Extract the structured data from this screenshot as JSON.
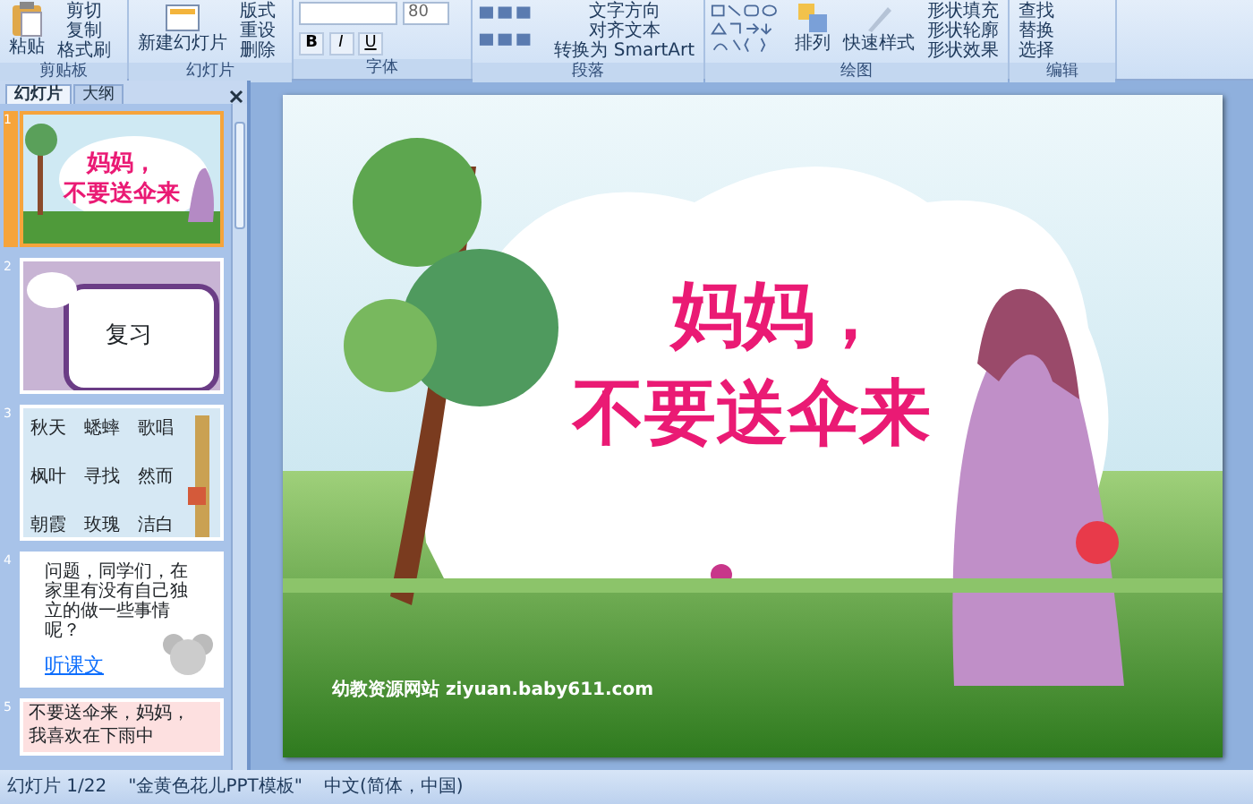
{
  "ribbon": {
    "groups": [
      {
        "label": "剪贴板",
        "items": [
          {
            "label": "粘贴",
            "kind": "large"
          },
          {
            "label": "剪切",
            "kind": "small"
          },
          {
            "label": "复制",
            "kind": "small"
          },
          {
            "label": "格式刷",
            "kind": "small"
          }
        ]
      },
      {
        "label": "幻灯片",
        "items": [
          {
            "label": "新建幻灯片",
            "kind": "large"
          },
          {
            "label": "版式",
            "kind": "small"
          },
          {
            "label": "重设",
            "kind": "small"
          },
          {
            "label": "删除",
            "kind": "small"
          }
        ]
      },
      {
        "label": "字体",
        "items": [
          {
            "label": "80",
            "kind": "fontsize"
          },
          {
            "label": "B",
            "kind": "format"
          },
          {
            "label": "I",
            "kind": "format"
          },
          {
            "label": "U",
            "kind": "format"
          }
        ]
      },
      {
        "label": "段落",
        "items": [
          {
            "label": "文字方向",
            "kind": "small"
          },
          {
            "label": "对齐文本",
            "kind": "small"
          },
          {
            "label": "转换为 SmartArt",
            "kind": "small"
          }
        ]
      },
      {
        "label": "绘图",
        "items": [
          {
            "label": "排列",
            "kind": "large"
          },
          {
            "label": "快速样式",
            "kind": "large"
          },
          {
            "label": "形状填充",
            "kind": "small"
          },
          {
            "label": "形状轮廓",
            "kind": "small"
          },
          {
            "label": "形状效果",
            "kind": "small"
          }
        ]
      },
      {
        "label": "编辑",
        "items": [
          {
            "label": "查找",
            "kind": "small"
          },
          {
            "label": "替换",
            "kind": "small"
          },
          {
            "label": "选择",
            "kind": "small"
          }
        ]
      }
    ]
  },
  "panel": {
    "tabs": [
      {
        "label": "幻灯片",
        "selected": true
      },
      {
        "label": "大纲",
        "selected": false
      }
    ],
    "slides": [
      {
        "number": "1",
        "selected": true,
        "kind": "title",
        "lines": [
          "妈妈，",
          "不要送伞来"
        ]
      },
      {
        "number": "2",
        "selected": false,
        "kind": "review",
        "lines": [
          "复习"
        ]
      },
      {
        "number": "3",
        "selected": false,
        "kind": "words",
        "lines": [
          "秋天",
          "蟋蟀",
          "歌唱",
          "枫叶",
          "寻找",
          "然而",
          "朝霞",
          "玫瑰",
          "洁白"
        ]
      },
      {
        "number": "4",
        "selected": false,
        "kind": "question",
        "lines": [
          "问题，同学们，在家里有没有自己独立的做一些事情呢？",
          "听课文"
        ]
      },
      {
        "number": "5",
        "selected": false,
        "kind": "text",
        "lines": [
          "不要送伞来，妈妈，",
          "我喜欢在下雨中"
        ]
      }
    ]
  },
  "slide": {
    "title_lines": [
      "妈妈，",
      "不要送伞来"
    ],
    "footer": "幼教资源网站 ziyuan.baby611.com"
  },
  "status_bar": {
    "slide": "幻灯片 1/22",
    "theme": "\"金黄色花儿PPT模板\"",
    "language": "中文(简体，中国)"
  }
}
